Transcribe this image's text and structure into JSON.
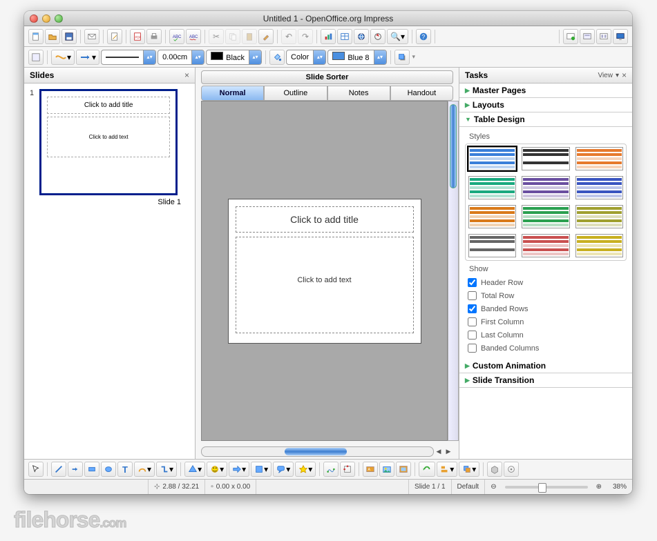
{
  "window": {
    "title": "Untitled 1 - OpenOffice.org Impress"
  },
  "toolbar2": {
    "line_width": "0.00cm",
    "color1_label": "Black",
    "fill_mode": "Color",
    "color2_label": "Blue 8"
  },
  "slides_panel": {
    "title": "Slides",
    "slide_number": "1",
    "thumb_title": "Click to add title",
    "thumb_text": "Click to add text",
    "slide_label": "Slide 1"
  },
  "center": {
    "sorter_label": "Slide Sorter",
    "tabs": [
      "Normal",
      "Outline",
      "Notes",
      "Handout"
    ],
    "canvas_title": "Click to add title",
    "canvas_text": "Click to add text"
  },
  "tasks": {
    "title": "Tasks",
    "view_label": "View",
    "sections": {
      "master": "Master Pages",
      "layouts": "Layouts",
      "table": "Table Design",
      "custom": "Custom Animation",
      "transition": "Slide Transition"
    },
    "styles_label": "Styles",
    "show_label": "Show",
    "checks": [
      {
        "label": "Header Row",
        "checked": true
      },
      {
        "label": "Total Row",
        "checked": false
      },
      {
        "label": "Banded Rows",
        "checked": true
      },
      {
        "label": "First Column",
        "checked": false
      },
      {
        "label": "Last Column",
        "checked": false
      },
      {
        "label": "Banded Columns",
        "checked": false
      }
    ],
    "style_colors": [
      "#3a7fd9",
      "#333",
      "#e67a2e",
      "#1aa97f",
      "#6a4fa0",
      "#3a55c0",
      "#d97a1a",
      "#2aa050",
      "#a0a030",
      "#666",
      "#c95050",
      "#c8b020"
    ]
  },
  "status": {
    "coords": "2.88 / 32.21",
    "size": "0.00 x 0.00",
    "slide_info": "Slide 1 / 1",
    "mode": "Default",
    "zoom": "38%"
  },
  "watermark": {
    "brand": "filehorse",
    "tld": ".com"
  }
}
